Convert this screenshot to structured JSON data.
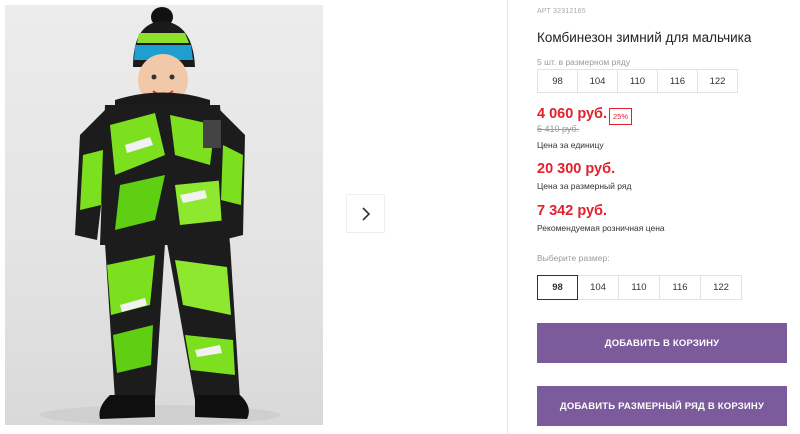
{
  "product": {
    "article": "АРТ 32312165",
    "title": "Комбинезон зимний для мальчика",
    "series_label": "5 шт. в размерном ряду",
    "series_sizes": [
      "98",
      "104",
      "110",
      "116",
      "122"
    ],
    "price_unit": "4 060 руб.",
    "discount": "25%",
    "old_price": "5 410 руб.",
    "price_unit_label": "Цена за единицу",
    "price_series": "20 300 руб.",
    "price_series_label": "Цена за размерный ряд",
    "price_retail": "7 342 руб.",
    "price_retail_label": "Рекомендуемая розничная цена",
    "choose_size_label": "Выберите размер:",
    "sizes": [
      "98",
      "104",
      "110",
      "116",
      "122"
    ],
    "selected_size": "98"
  },
  "buttons": {
    "add_to_cart": "ДОБАВИТЬ В КОРЗИНУ",
    "add_series_to_cart": "ДОБАВИТЬ РАЗМЕРНЫЙ РЯД В КОРЗИНУ"
  },
  "icons": {
    "next": "chevron-right-icon"
  },
  "colors": {
    "accent": "#7b5b9b",
    "price": "#e3202e"
  }
}
